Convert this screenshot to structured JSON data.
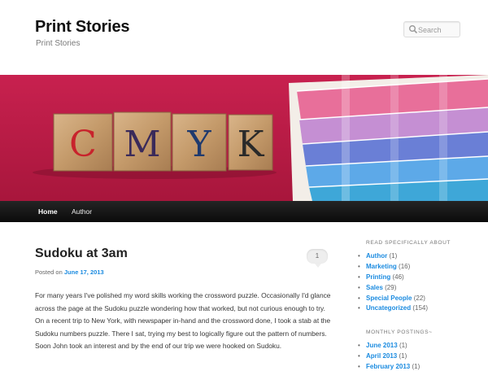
{
  "site": {
    "title": "Print Stories",
    "description": "Print Stories"
  },
  "search": {
    "placeholder": "Search",
    "icon": "search-icon"
  },
  "banner": {
    "letters": [
      "C",
      "M",
      "Y",
      "K"
    ],
    "letter_colors": [
      "#c8232c",
      "#3a2a5a",
      "#1f3a6e",
      "#2a2a2a"
    ]
  },
  "nav": {
    "items": [
      {
        "label": "Home"
      },
      {
        "label": "Author"
      }
    ]
  },
  "post": {
    "title": "Sudoku at 3am",
    "comment_count": "1",
    "posted_prefix": "Posted on",
    "date": "June 17, 2013",
    "body": "For many years I've polished my word skills working the crossword puzzle. Occasionally I'd glance across the page at the Sudoku puzzle wondering how that worked, but not curious enough to try. On a recent trip to New York, with newspaper in-hand and the crossword done, I took a stab at the Sudoku numbers puzzle. There I sat, trying my best to logically figure out the pattern of numbers. Soon John took an interest and by the end of our trip we were hooked on Sudoku."
  },
  "sidebar": {
    "categories_title": "Read Specifically About",
    "categories": [
      {
        "name": "Author",
        "count": "(1)"
      },
      {
        "name": "Marketing",
        "count": "(16)"
      },
      {
        "name": "Printing",
        "count": "(46)"
      },
      {
        "name": "Sales",
        "count": "(29)"
      },
      {
        "name": "Special People",
        "count": "(22)"
      },
      {
        "name": "Uncategorized",
        "count": "(154)"
      }
    ],
    "archives_title": "Monthly Postings~",
    "archives": [
      {
        "name": "June 2013",
        "count": "(1)"
      },
      {
        "name": "April 2013",
        "count": "(1)"
      },
      {
        "name": "February 2013",
        "count": "(1)"
      }
    ]
  },
  "colors": {
    "link": "#1b8be0",
    "nav_bg": "#111111",
    "banner_bg": "#c41e4c"
  }
}
